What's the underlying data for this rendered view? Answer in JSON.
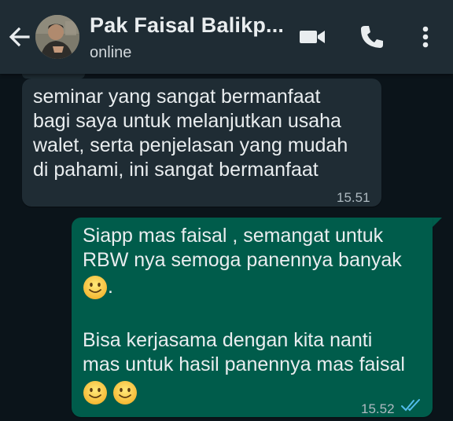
{
  "header": {
    "contact_name": "Pak Faisal Balikp...",
    "status": "online",
    "icons": [
      "back-arrow-icon",
      "video-call-icon",
      "voice-call-icon",
      "more-options-icon"
    ]
  },
  "messages": [
    {
      "direction": "incoming",
      "lines": [
        "seminar yang sangat bermanfaat",
        "bagi saya untuk melanjutkan usaha",
        "walet, serta penjelasan yang mudah",
        "di pahami, ini sangat bermanfaat"
      ],
      "time": "15.51"
    },
    {
      "direction": "outgoing",
      "lines": [
        "Siapp mas faisal , semangat untuk",
        "RBW nya semoga panennya banyak",
        ".",
        "Bisa kerjasama dengan kita nanti",
        "mas untuk hasil panennya mas faisal"
      ],
      "emojis": [
        "slightly-smiling-face",
        "slightly-smiling-face",
        "slightly-smiling-face"
      ],
      "time": "15.52",
      "read_receipt": "double-check-icon"
    }
  ],
  "colors": {
    "header_bg": "#1f2c34",
    "chat_bg": "#0b141a",
    "incoming_bubble": "#1f2c34",
    "outgoing_bubble": "#005c4b",
    "read_tick": "#53bdeb"
  }
}
